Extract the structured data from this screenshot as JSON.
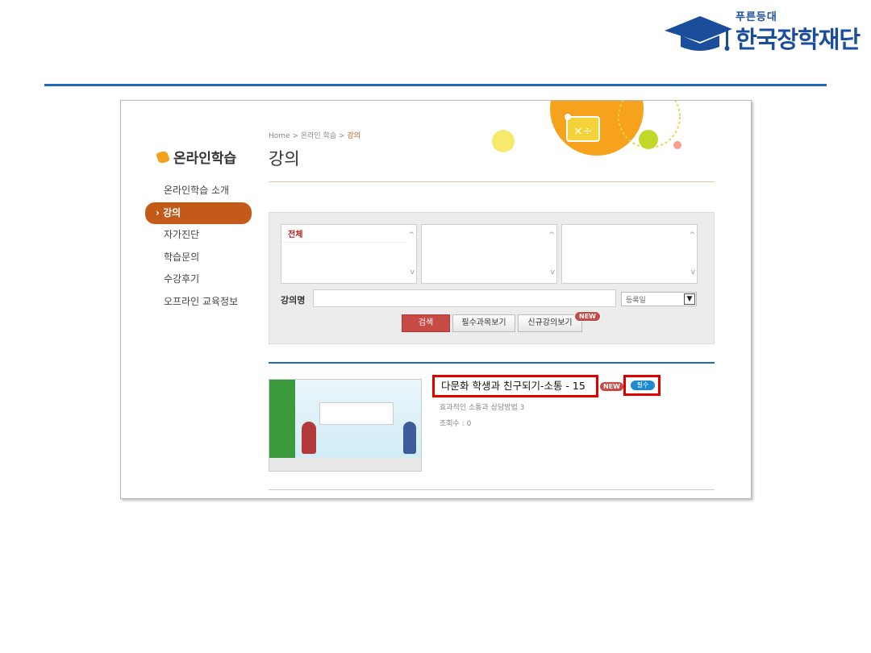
{
  "brand": {
    "tagline": "푸른등대",
    "name": "한국장학재단",
    "color": "#1a4e9c"
  },
  "sidebar": {
    "title": "온라인학습",
    "items": [
      {
        "label": "온라인학습 소개"
      },
      {
        "label": "› 강의",
        "active": true
      },
      {
        "label": "자가진단"
      },
      {
        "label": "학습문의"
      },
      {
        "label": "수강후기"
      },
      {
        "label": "오프라인 교육정보"
      }
    ]
  },
  "breadcrumb": {
    "path": "Home > 온라인 학습 > ",
    "current": "강의"
  },
  "page_title": "강의",
  "search": {
    "category_selected": "전체",
    "keyword_label": "강의명",
    "keyword_value": "",
    "sort_value": "등록일",
    "search_label": "검색",
    "required_label": "필수과목보기",
    "new_courses_label": "신규강의보기",
    "new_badge": "NEW"
  },
  "results": [
    {
      "title": "다문화 학생과 친구되기-소통 - 15",
      "new_badge": "NEW",
      "required_badge": "필수",
      "subtitle": "효과적인 소통과 상담방법 3",
      "views": "조회수 : 0"
    }
  ],
  "colors": {
    "accent_orange": "#c35a1a",
    "accent_blue": "#1e6cb8",
    "highlight_red": "#e00000"
  }
}
